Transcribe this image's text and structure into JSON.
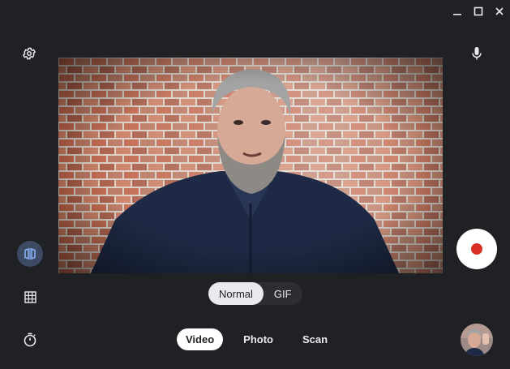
{
  "window_controls": {
    "minimize_icon": "minimize-icon",
    "maximize_icon": "maximize-icon",
    "close_icon": "close-icon"
  },
  "left_rail": {
    "settings_icon": "gear-icon",
    "mirror_icon": "mirror-icon",
    "grid_icon": "grid-icon",
    "timer_icon": "timer-icon"
  },
  "right_rail": {
    "mic_icon": "microphone-icon",
    "record_icon": "record-icon"
  },
  "video_modes": {
    "options": [
      "Normal",
      "GIF"
    ],
    "selected": "Normal"
  },
  "capture_modes": {
    "tabs": [
      "Video",
      "Photo",
      "Scan"
    ],
    "selected": "Video"
  },
  "colors": {
    "background": "#202124",
    "accent_record": "#d93025",
    "pill_selected": "#e8eaed"
  }
}
